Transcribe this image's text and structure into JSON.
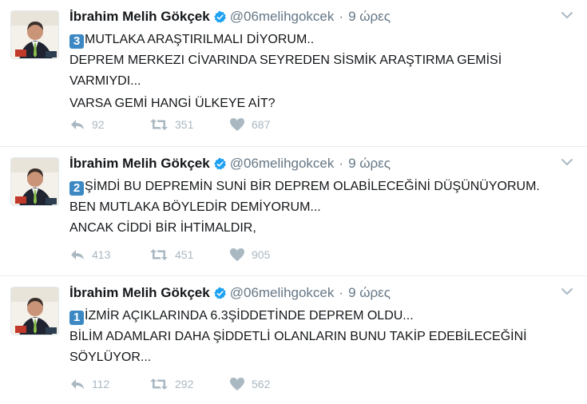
{
  "colors": {
    "keycap": "#3b88c3",
    "verified": "#1da1f2",
    "muted": "#657786",
    "action_icon": "#aab8c2"
  },
  "tweets": [
    {
      "author": {
        "name": "İbrahim Melih Gökçek",
        "handle": "@06melihgokcek"
      },
      "time": "9 ώρες",
      "keycap": "3",
      "lines": [
        "MUTLAKA ARAŞTIRILMALI DİYORUM..",
        "DEPREM MERKEZI CİVARINDA SEYREDEN SİSMİK ARAŞTIRMA GEMİSİ",
        "VARMIYDI...",
        "VARSA GEMİ HANGİ ÜLKEYE AİT?"
      ],
      "stats": {
        "replies": "92",
        "retweets": "351",
        "likes": "687"
      }
    },
    {
      "author": {
        "name": "İbrahim Melih Gökçek",
        "handle": "@06melihgokcek"
      },
      "time": "9 ώρες",
      "keycap": "2",
      "lines": [
        "ŞİMDİ BU DEPREMİN SUNİ BİR DEPREM OLABİLECEĞİNİ DÜŞÜNÜYORUM.",
        "BEN MUTLAKA BÖYLEDİR DEMİYORUM...",
        "ANCAK CİDDİ BİR İHTİMALDIR,"
      ],
      "stats": {
        "replies": "413",
        "retweets": "451",
        "likes": "905"
      }
    },
    {
      "author": {
        "name": "İbrahim Melih Gökçek",
        "handle": "@06melihgokcek"
      },
      "time": "9 ώρες",
      "keycap": "1",
      "lines": [
        "İZMİR AÇIKLARINDA 6.3ŞİDDETİNDE DEPREM OLDU...",
        "BİLİM ADAMLARI DAHA ŞİDDETLİ OLANLARIN BUNU TAKİP EDEBİLECEĞİNİ",
        "SÖYLÜYOR..."
      ],
      "stats": {
        "replies": "112",
        "retweets": "292",
        "likes": "562"
      }
    }
  ]
}
